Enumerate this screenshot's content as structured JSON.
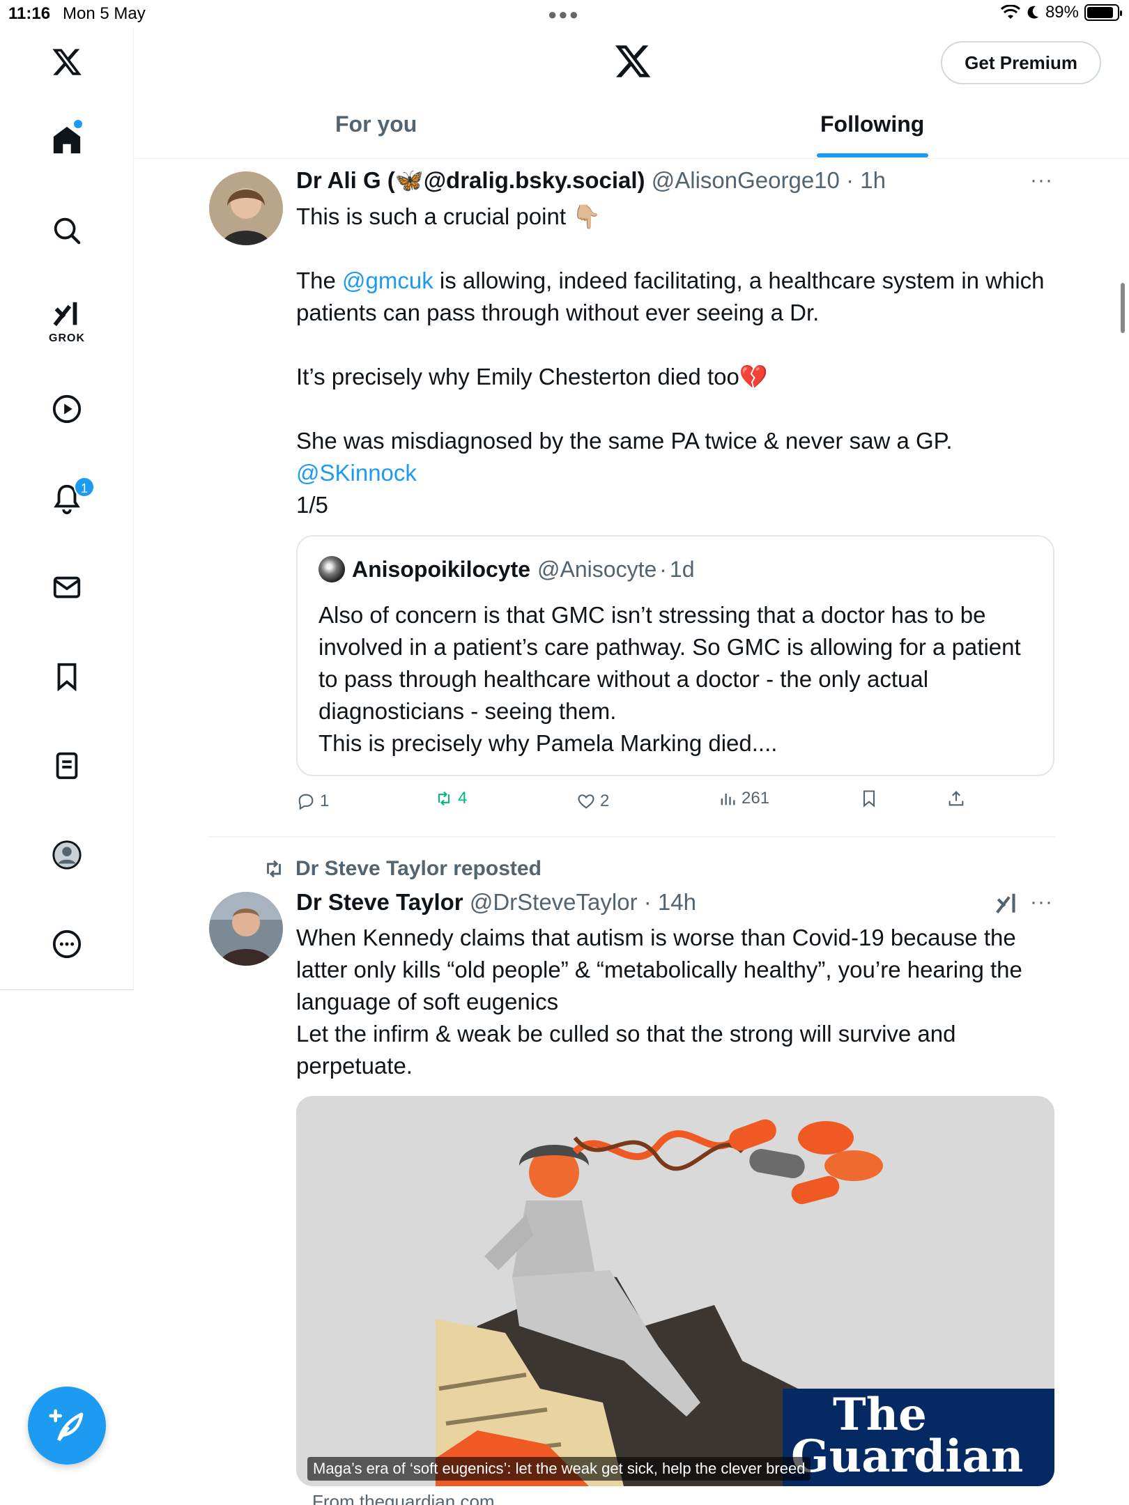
{
  "status_bar": {
    "time": "11:16",
    "date": "Mon 5 May",
    "battery": "89%",
    "battery_level": 0.89
  },
  "sidebar": {
    "items": [
      {
        "icon": "x-logo-icon"
      },
      {
        "icon": "home-icon"
      },
      {
        "icon": "search-icon"
      },
      {
        "icon": "grok-icon",
        "label": "GROK"
      },
      {
        "icon": "play-icon"
      },
      {
        "icon": "bell-icon",
        "badge": "1"
      },
      {
        "icon": "mail-icon"
      },
      {
        "icon": "bookmark-icon"
      },
      {
        "icon": "list-icon"
      },
      {
        "icon": "profile-icon"
      },
      {
        "icon": "more-circle-icon"
      }
    ],
    "compose_icon": "compose-plus-icon"
  },
  "header": {
    "premium_label": "Get Premium",
    "tabs": [
      {
        "label": "For you",
        "active": false
      },
      {
        "label": "Following",
        "active": true
      }
    ]
  },
  "tweets": [
    {
      "name": "Dr Ali G (",
      "name_suffix": "@dralig.bsky.social)",
      "handle": "@AlisonGeorge10",
      "time": "1h",
      "text": {
        "line1": "This is such a crucial point 👇🏼",
        "p2_pre": "The ",
        "p2_mention": "@gmcuk",
        "p2_post": " is allowing, indeed facilitating, a healthcare system in which patients can pass through without ever seeing a Dr.",
        "p3": "It’s precisely why Emily Chesterton died too💔",
        "p4": "She was misdiagnosed by the same PA twice & never saw a GP.",
        "p4_mention": "@SKinnock",
        "p4_count": "1/5"
      },
      "quote": {
        "name": "Anisopoikilocyte",
        "handle": "@Anisocyte",
        "time": "1d",
        "text": "Also of concern is that GMC isn’t stressing that a doctor has to be involved in a patient’s care pathway. So GMC is allowing for a patient to pass through healthcare without a doctor - the only actual diagnosticians - seeing them.",
        "text2": "This is precisely why Pamela Marking died...."
      },
      "stats": {
        "replies": "1",
        "reposts": "4",
        "likes": "2",
        "views": "261"
      }
    },
    {
      "reposted_by": "Dr Steve Taylor reposted",
      "name": "Dr Steve Taylor",
      "handle": "@DrSteveTaylor",
      "time": "14h",
      "text": {
        "p1": "When Kennedy claims that autism is worse than Covid-19 because the latter only kills “old people” & “metabolically healthy”, you’re hearing the language of soft eugenics",
        "p2": "Let the infirm & weak be culled so that the strong will survive and perpetuate."
      },
      "card": {
        "caption": "Maga’s era of ‘soft eugenics’: let the weak get sick, help the clever breed",
        "brand_line1": "The",
        "brand_line2": "Guardian",
        "source": "From theguardian.com"
      }
    }
  ],
  "colors": {
    "accent": "#1d9bf0",
    "repost_green": "#00ba7c",
    "muted": "#536471",
    "guardian_blue": "#052962"
  }
}
